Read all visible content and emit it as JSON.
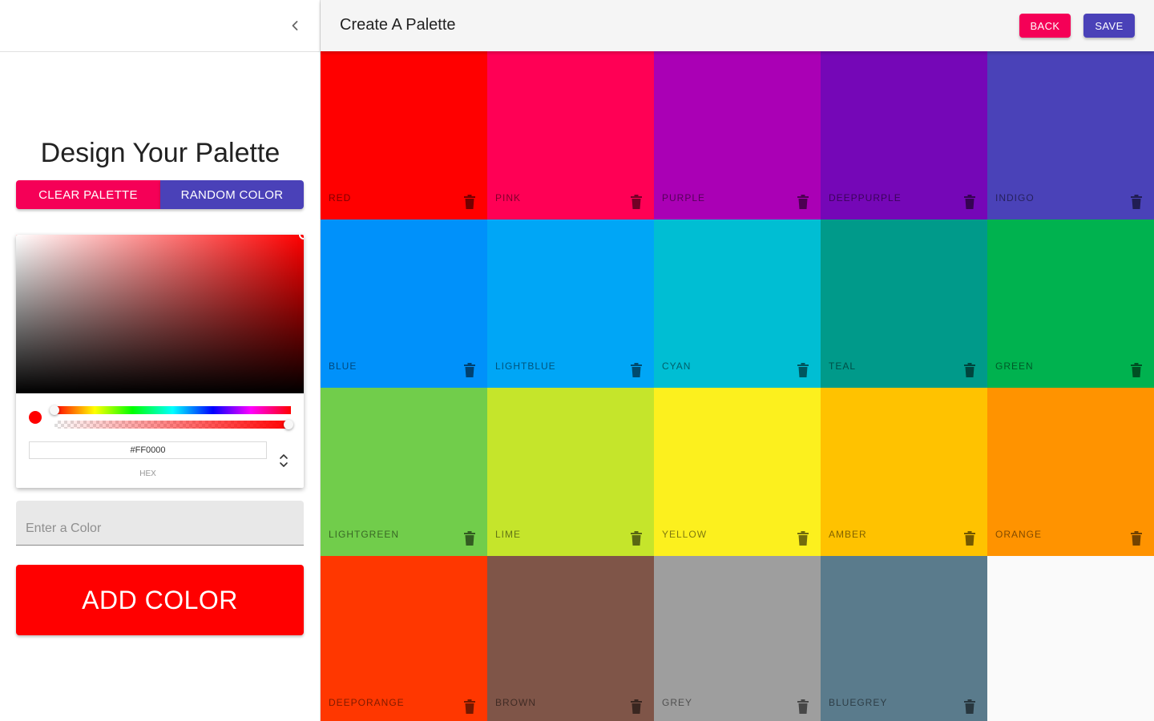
{
  "drawer": {
    "title": "Design Your Palette",
    "clear_label": "CLEAR PALETTE",
    "random_label": "RANDOM COLOR",
    "picker": {
      "current_color": "#FF0000",
      "hex_value": "#FF0000",
      "hex_label": "HEX",
      "hue": 0,
      "alpha": 1
    },
    "input_placeholder": "Enter a Color",
    "input_value": "",
    "add_label": "ADD COLOR"
  },
  "appbar": {
    "title": "Create A Palette",
    "back_label": "BACK",
    "save_label": "SAVE"
  },
  "colors": [
    {
      "name": "RED",
      "color": "#FF0000"
    },
    {
      "name": "PINK",
      "color": "#FF0055"
    },
    {
      "name": "PURPLE",
      "color": "#AA00B5"
    },
    {
      "name": "DEEPPURPLE",
      "color": "#7507B7"
    },
    {
      "name": "INDIGO",
      "color": "#4A42B8"
    },
    {
      "name": "BLUE",
      "color": "#0091FA"
    },
    {
      "name": "LIGHTBLUE",
      "color": "#00A6F6"
    },
    {
      "name": "CYAN",
      "color": "#00BED3"
    },
    {
      "name": "TEAL",
      "color": "#009A8A"
    },
    {
      "name": "GREEN",
      "color": "#00B24F"
    },
    {
      "name": "LIGHTGREEN",
      "color": "#71CD4B"
    },
    {
      "name": "LIME",
      "color": "#C5E52B"
    },
    {
      "name": "YELLOW",
      "color": "#FCF01E"
    },
    {
      "name": "AMBER",
      "color": "#FFC200"
    },
    {
      "name": "ORANGE",
      "color": "#FF9300"
    },
    {
      "name": "DEEPORANGE",
      "color": "#FF3700"
    },
    {
      "name": "BROWN",
      "color": "#7F5548"
    },
    {
      "name": "GREY",
      "color": "#9E9E9E"
    },
    {
      "name": "BLUEGREY",
      "color": "#5A7B8C"
    }
  ]
}
